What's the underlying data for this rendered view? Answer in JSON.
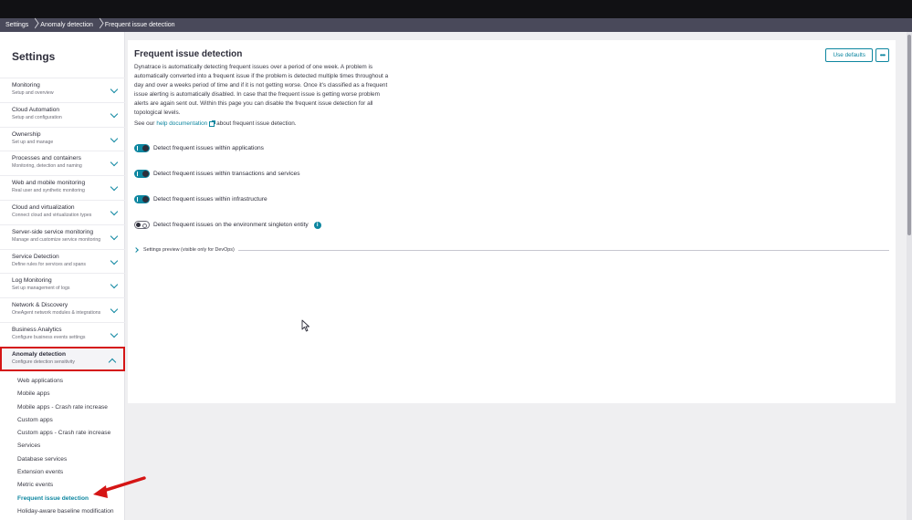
{
  "breadcrumb": {
    "items": [
      "Settings",
      "Anomaly detection",
      "Frequent issue detection"
    ]
  },
  "sidebar": {
    "title": "Settings",
    "items": [
      {
        "label": "Monitoring",
        "sub": "Setup and overview"
      },
      {
        "label": "Cloud Automation",
        "sub": "Setup and configuration"
      },
      {
        "label": "Ownership",
        "sub": "Set up and manage"
      },
      {
        "label": "Processes and containers",
        "sub": "Monitoring, detection and naming"
      },
      {
        "label": "Web and mobile monitoring",
        "sub": "Real user and synthetic monitoring"
      },
      {
        "label": "Cloud and virtualization",
        "sub": "Connect cloud and virtualization types"
      },
      {
        "label": "Server-side service monitoring",
        "sub": "Manage and customize service monitoring"
      },
      {
        "label": "Service Detection",
        "sub": "Define rules for services and spans"
      },
      {
        "label": "Log Monitoring",
        "sub": "Set up management of logs"
      },
      {
        "label": "Network & Discovery",
        "sub": "OneAgent network modules & integrations"
      },
      {
        "label": "Business Analytics",
        "sub": "Configure business events settings"
      },
      {
        "label": "Anomaly detection",
        "sub": "Configure detection sensitivity"
      }
    ],
    "subitems": [
      "Web applications",
      "Mobile apps",
      "Mobile apps - Crash rate increase",
      "Custom apps",
      "Custom apps - Crash rate increase",
      "Services",
      "Database services",
      "Extension events",
      "Metric events",
      "Frequent issue detection",
      "Holiday-aware baseline modification"
    ]
  },
  "main": {
    "title": "Frequent issue detection",
    "description": "Dynatrace is automatically detecting frequent issues over a period of one week. A problem is automatically converted into a frequent issue if the problem is detected multiple times throughout a day and over a weeks period of time and if it is not getting worse. Once it's classified as a frequent issue alerting is automatically disabled. In case that the frequent issue is getting worse problem alerts are again sent out. Within this page you can disable the frequent issue detection for all topological levels.",
    "see_our": "See our",
    "help_link": "help documentation",
    "help_suffix": "about frequent issue detection.",
    "use_defaults": "Use defaults",
    "more": "•••",
    "toggles": [
      {
        "label": "Detect frequent issues within applications",
        "on": true
      },
      {
        "label": "Detect frequent issues within transactions and services",
        "on": true
      },
      {
        "label": "Detect frequent issues within infrastructure",
        "on": true
      },
      {
        "label": "Detect frequent issues on the environment singleton entity",
        "on": false
      }
    ],
    "info": "i",
    "preview_label": "Settings preview (visible only for DevOps)"
  },
  "colors": {
    "accent": "#0d86a0",
    "highlight": "#d51515",
    "topbar": "#111114",
    "breadcrumb_bg": "#49495a"
  }
}
